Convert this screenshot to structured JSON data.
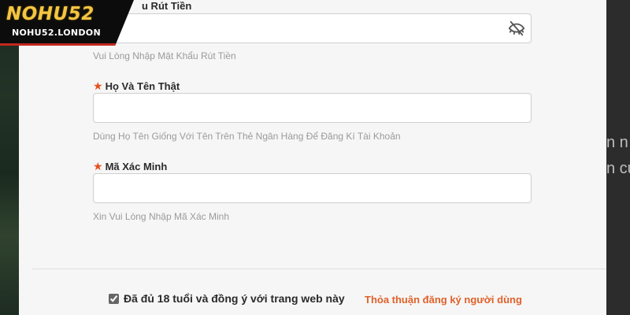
{
  "brand": {
    "name": "NOHU52",
    "domain": "NOHU52.LONDON"
  },
  "form": {
    "withdraw_password": {
      "label": "u Rút Tiền",
      "hint": "Vui Lòng Nhập Mật Khẩu Rút Tiền",
      "icon": "eye-off-icon"
    },
    "real_name": {
      "label": "Họ Và Tên Thật",
      "hint": "Dùng Họ Tên Giống Với Tên Trên Thẻ Ngân Hàng Để Đăng Kí Tài Khoản",
      "required": true
    },
    "verification_code": {
      "label": "Mã Xác Minh",
      "hint": "Xin Vui Lòng Nhập Mã Xác Minh",
      "required": true
    }
  },
  "agreement": {
    "checked": true,
    "text": "Đã đủ 18 tuổi và đồng ý với trang web này",
    "link": "Thỏa thuận đăng ký người dùng"
  },
  "background": {
    "right_text_1": "n n",
    "right_text_2": "n cử"
  },
  "colors": {
    "accent": "#e8501d",
    "link": "#e0612a",
    "logo_gold": "#f3c542",
    "logo_red": "#c2281f"
  }
}
